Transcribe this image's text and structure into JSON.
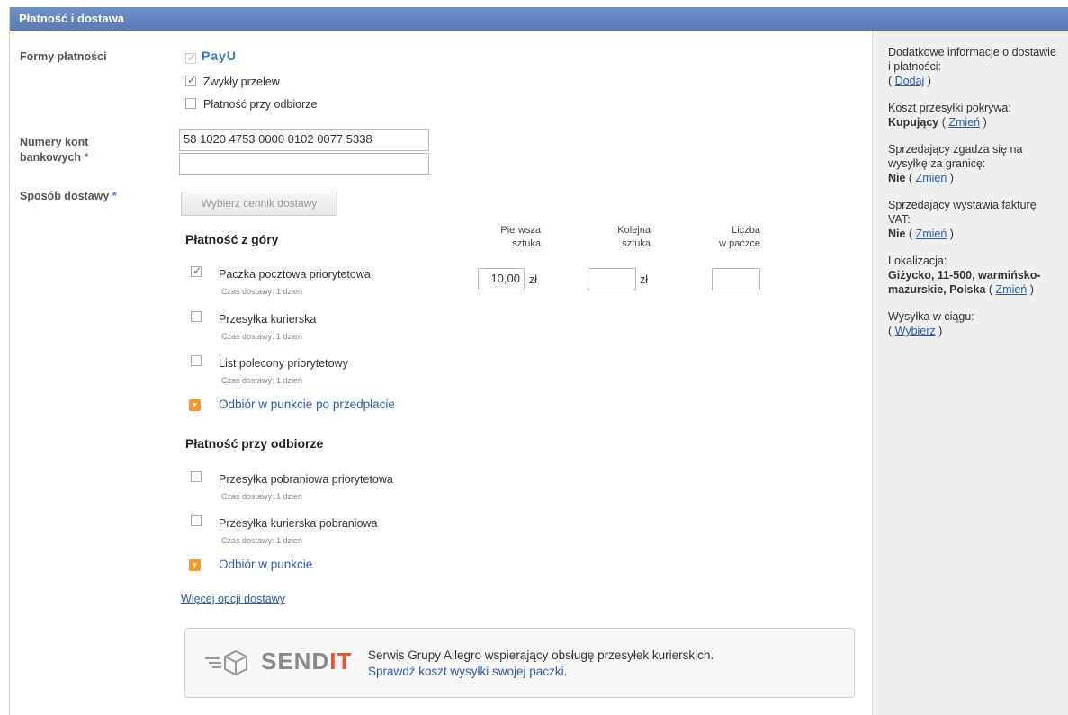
{
  "header": {
    "title": "Płatność i dostawa"
  },
  "payment": {
    "label": "Formy płatności",
    "payu": "PayU",
    "options": [
      "Zwykły przelew",
      "Płatność przy odbiorze"
    ]
  },
  "accounts": {
    "label_line1": "Numery kont",
    "label_line2": "bankowych",
    "account1": "58 1020 4753 0000 0102 0077 5338",
    "account2": ""
  },
  "delivery": {
    "label": "Sposób dostawy",
    "button": "Wybierz cennik dostawy",
    "columns": {
      "first": [
        "Pierwsza",
        "sztuka"
      ],
      "next": [
        "Kolejna",
        "sztuka"
      ],
      "count": [
        "Liczba",
        "w paczce"
      ]
    },
    "section_prepaid": "Płatność z góry",
    "prepaid_items": [
      {
        "name": "Paczka pocztowa priorytetowa",
        "time": "Czas dostawy: 1 dzień",
        "checked": true,
        "first_price": "10,00",
        "currency": "zł"
      },
      {
        "name": "Przesyłka kurierska",
        "time": "Czas dostawy: 1 dzień",
        "checked": false
      },
      {
        "name": "List polecony priorytetowy",
        "time": "Czas dostawy: 1 dzień",
        "checked": false
      }
    ],
    "prepaid_pickup": "Odbiór w punkcie po przedpłacie",
    "section_cod": "Płatność przy odbiorze",
    "cod_items": [
      {
        "name": "Przesyłka pobraniowa priorytetowa",
        "time": "Czas dostawy: 1 dzień",
        "checked": false
      },
      {
        "name": "Przesyłka kurierska pobraniowa",
        "time": "Czas dostawy: 1 dzień",
        "checked": false
      }
    ],
    "cod_pickup": "Odbiór w punkcie",
    "more_options": "Więcej opcji dostawy"
  },
  "sendit": {
    "logo": "SENDIT",
    "desc": "Serwis Grupy Allegro wspierający obsługę przesyłek kurierskich.",
    "link": "Sprawdź koszt wysyłki swojej paczki."
  },
  "sidebar": {
    "extra_info": "Dodatkowe informacje o dostawie i płatności:",
    "add": "Dodaj",
    "cost_label": "Koszt przesyłki pokrywa:",
    "cost_value": "Kupujący",
    "abroad_label": "Sprzedający zgadza się na wysyłkę za granicę:",
    "abroad_value": "Nie",
    "vat_label": "Sprzedający wystawia fakturę VAT:",
    "vat_value": "Nie",
    "location_label": "Lokalizacja:",
    "location_value": "Giżycko, 11-500, warmińsko-mazurskie, Polska",
    "shipping_label": "Wysyłka w ciągu:",
    "choose": "Wybierz",
    "change": "Zmień"
  }
}
